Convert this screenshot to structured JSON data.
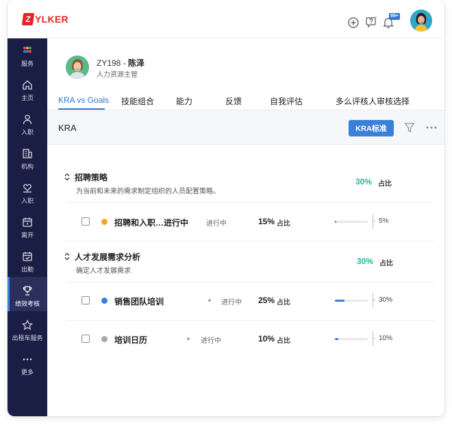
{
  "brand": {
    "logo_mark": "Z",
    "logo_text": "YLKER",
    "color": "#e42527"
  },
  "topbar": {
    "icons": [
      "add-circle-icon",
      "help-icon",
      "bell-icon"
    ],
    "notification_badge": "99+"
  },
  "sidebar": {
    "items": [
      {
        "label": "服务",
        "icon": "apps-grid-icon"
      },
      {
        "label": "主页",
        "icon": "home-icon"
      },
      {
        "label": "入职",
        "icon": "user-icon"
      },
      {
        "label": "机构",
        "icon": "building-icon"
      },
      {
        "label": "入职",
        "icon": "heart-hands-icon"
      },
      {
        "label": "离开",
        "icon": "calendar-icon"
      },
      {
        "label": "出勤",
        "icon": "calendar-check-icon"
      },
      {
        "label": "绩效考核",
        "icon": "trophy-icon",
        "active": true
      },
      {
        "label": "出租车服务",
        "icon": "star-icon"
      },
      {
        "label": "更多",
        "icon": "dots-icon"
      }
    ],
    "bg_color": "#1b1e44"
  },
  "profile": {
    "id": "ZY198 -",
    "name": "陈泽",
    "role": "人力资源主管"
  },
  "tabs": [
    {
      "label": "KRA vs Goals",
      "active": true
    },
    {
      "label": "技能组合"
    },
    {
      "label": "能力"
    },
    {
      "label": "反馈"
    },
    {
      "label": "自我评估"
    },
    {
      "label": "多么评核人审核选择"
    }
  ],
  "kra_header": {
    "title": "KRA",
    "button_label": "KRA标准",
    "accent": "#3a7fd8"
  },
  "sections": [
    {
      "title": "招聘策略",
      "description": "为当前和未来的需求制定组织的人员配置策略。",
      "weight": "30%",
      "weight_unit": "占比",
      "rows": [
        {
          "name": "招聘和入职…进行中",
          "status": "进行中",
          "dot_color": "#f5a623",
          "weight": "15%",
          "weight_unit": "占比",
          "progress": "5%",
          "progress_value": 0.05
        }
      ]
    },
    {
      "title": "人才发展需求分析",
      "description": "确定人才发展需求",
      "weight": "30%",
      "weight_unit": "占比",
      "rows": [
        {
          "name": "销售团队培训",
          "status": "进行中",
          "dot_color": "#3a7fd8",
          "weight": "25%",
          "weight_unit": "占比",
          "progress": "30%",
          "progress_value": 0.3
        },
        {
          "name": "培训日历",
          "status": "进行中",
          "dot_color": "#a5a9b2",
          "weight": "10%",
          "weight_unit": "占比",
          "progress": "10%",
          "progress_value": 0.1
        }
      ]
    }
  ],
  "colors": {
    "accent": "#2f77d4",
    "success": "#23b89a"
  }
}
